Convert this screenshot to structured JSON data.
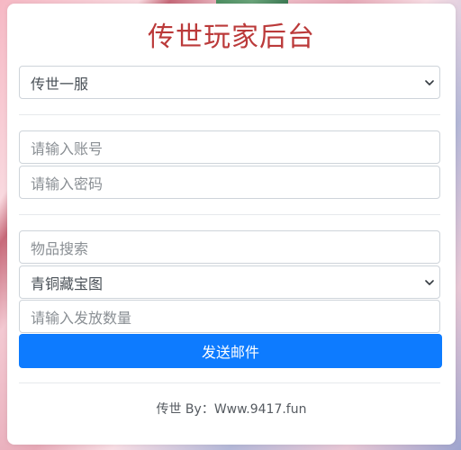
{
  "app": {
    "title": "传世玩家后台"
  },
  "server_select": {
    "selected": "传世一服"
  },
  "account": {
    "username_placeholder": "请输入账号",
    "password_placeholder": "请输入密码"
  },
  "mail": {
    "item_search_placeholder": "物品搜索",
    "item_selected": "青铜藏宝图",
    "quantity_placeholder": "请输入发放数量",
    "send_label": "发送邮件"
  },
  "footer": {
    "credit": "传世 By：Www.9417.fun"
  },
  "colors": {
    "title": "#bb3a3a",
    "primary_button": "#0d7bff"
  }
}
